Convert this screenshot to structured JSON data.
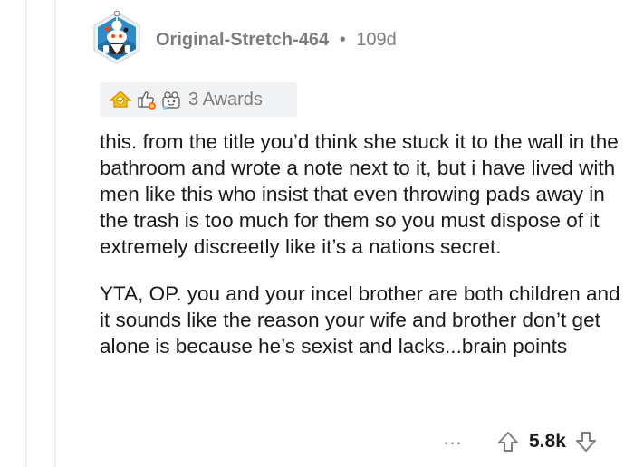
{
  "comment": {
    "author": "Original-Stretch-464",
    "separator": "•",
    "age": "109d",
    "awards_label": "3 Awards",
    "paragraphs": [
      "this. from the title you’d think she stuck it to the wall in the bathroom and wrote a note next to it, but i have lived with men like this who insist that even throwing pads away in the trash is too much for them so you must dispose of it extremely discreetly like it’s a nations secret.",
      "YTA, OP. you and your incel brother are both children and it sounds like the reason your wife and brother don’t get alone is because he’s sexist and lacks...brain points"
    ],
    "more_label": "...",
    "score": "5.8k"
  },
  "icons": {
    "avatar": "snoo-avatar-icon",
    "award_1": "gold-award-icon",
    "award_2": "wholesome-award-icon",
    "award_3": "silver-award-icon",
    "more": "more-options-icon",
    "upvote": "upvote-arrow-icon",
    "downvote": "downvote-arrow-icon"
  },
  "colors": {
    "avatar_bg": "#2e8bc9",
    "avatar_border": "#eef3f7",
    "text_primary": "#1a1a1b",
    "text_meta": "#7c7c7c",
    "awards_bg": "#f1f2f3",
    "thread_line": "#edeff1",
    "gold": "#f5c518"
  }
}
